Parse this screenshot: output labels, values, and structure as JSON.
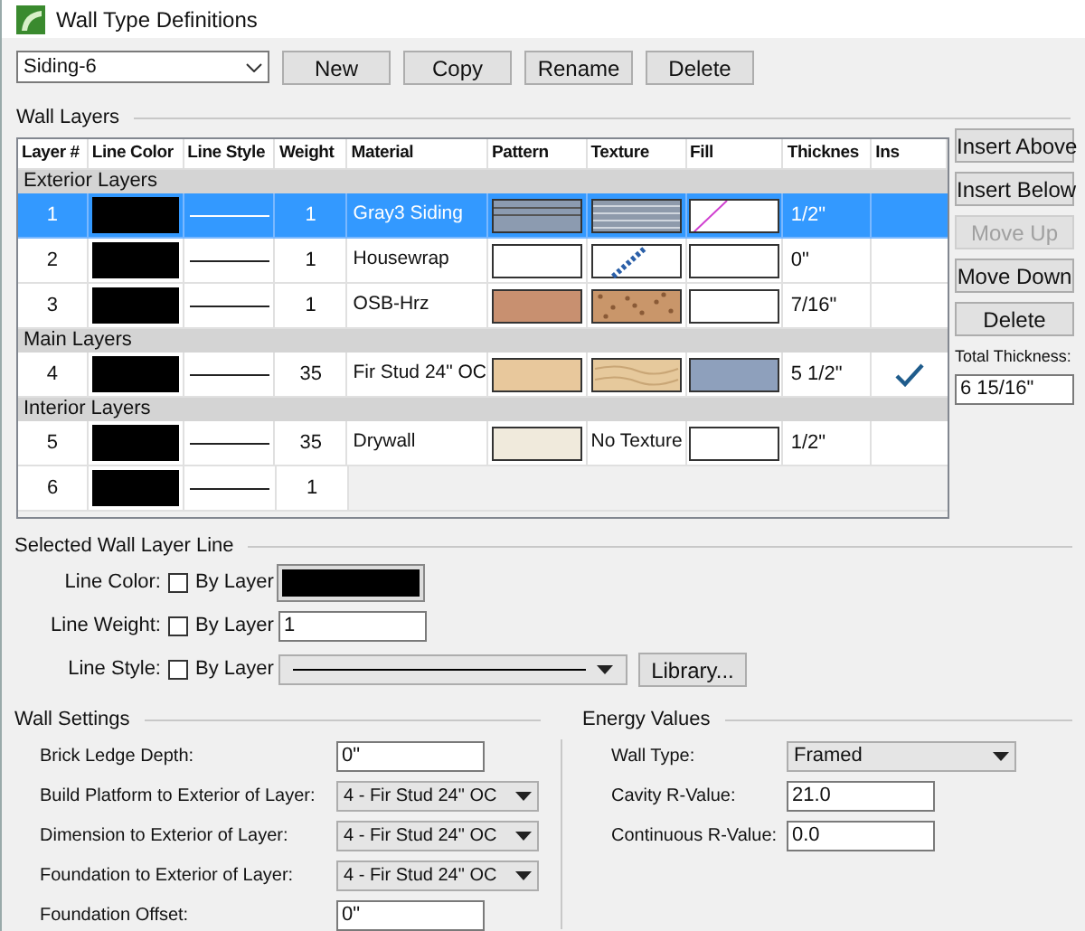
{
  "window": {
    "title": "Wall Type Definitions"
  },
  "toolbar": {
    "wall_type": "Siding-6",
    "buttons": [
      "New",
      "Copy",
      "Rename",
      "Delete"
    ]
  },
  "wall_layers": {
    "title": "Wall Layers",
    "columns": [
      "Layer #",
      "Line Color",
      "Line Style",
      "Weight",
      "Material",
      "Pattern",
      "Texture",
      "Fill",
      "Thicknes",
      "Ins"
    ],
    "rows": [
      {
        "kind": "group",
        "label": "Exterior Layers"
      },
      {
        "kind": "layer",
        "selected": true,
        "number": "1",
        "weight": "1",
        "material": "Gray3 Siding",
        "pattern": {
          "kind": "siding",
          "color": "#8c9bb0"
        },
        "texture": {
          "kind": "siding"
        },
        "fill": {
          "kind": "hatch",
          "color": "#ffffff"
        },
        "thickness": "1/2\"",
        "insulation": false
      },
      {
        "kind": "layer",
        "selected": false,
        "number": "2",
        "weight": "1",
        "material": "Housewrap",
        "pattern": {
          "kind": "plain",
          "color": "#ffffff"
        },
        "texture": {
          "kind": "wrap"
        },
        "fill": {
          "kind": "plain",
          "color": "#ffffff"
        },
        "thickness": "0\"",
        "insulation": false
      },
      {
        "kind": "layer",
        "selected": false,
        "number": "3",
        "weight": "1",
        "material": "OSB-Hrz",
        "pattern": {
          "kind": "plain",
          "color": "#c89070"
        },
        "texture": {
          "kind": "osb"
        },
        "fill": {
          "kind": "plain",
          "color": "#ffffff"
        },
        "thickness": "7/16\"",
        "insulation": false
      },
      {
        "kind": "group",
        "label": "Main Layers"
      },
      {
        "kind": "layer",
        "selected": false,
        "number": "4",
        "weight": "35",
        "material": "Fir Stud 24\" OC",
        "pattern": {
          "kind": "plain",
          "color": "#e8c89c"
        },
        "texture": {
          "kind": "wood"
        },
        "fill": {
          "kind": "plain",
          "color": "#8ea0bc"
        },
        "thickness": "5 1/2\"",
        "insulation": true
      },
      {
        "kind": "group",
        "label": "Interior Layers"
      },
      {
        "kind": "layer",
        "selected": false,
        "number": "5",
        "weight": "35",
        "material": "Drywall",
        "pattern": {
          "kind": "plain",
          "color": "#f0eadc"
        },
        "texture": {
          "kind": "none",
          "label": "No Texture"
        },
        "fill": {
          "kind": "plain",
          "color": "#ffffff"
        },
        "thickness": "1/2\"",
        "insulation": false
      },
      {
        "kind": "layer",
        "selected": false,
        "number": "6",
        "weight": "1"
      }
    ],
    "side_buttons": [
      {
        "label": "Insert Above",
        "disabled": false
      },
      {
        "label": "Insert Below",
        "disabled": false
      },
      {
        "label": "Move Up",
        "disabled": true
      },
      {
        "label": "Move Down",
        "disabled": false
      },
      {
        "label": "Delete",
        "disabled": false
      }
    ],
    "total_thickness": {
      "label": "Total Thickness:",
      "value": "6 15/16\""
    }
  },
  "selected_line": {
    "title": "Selected Wall Layer Line",
    "rows": [
      {
        "kind": "color",
        "label": "Line Color:",
        "by_layer": "By Layer",
        "checked": false
      },
      {
        "kind": "weight",
        "label": "Line Weight:",
        "by_layer": "By Layer",
        "checked": false,
        "value": "1"
      },
      {
        "kind": "style",
        "label": "Line Style:",
        "by_layer": "By Layer",
        "checked": false,
        "button": "Library..."
      }
    ]
  },
  "wall_settings": {
    "title": "Wall Settings",
    "fields": [
      {
        "kind": "input",
        "label": "Brick Ledge Depth:",
        "value": "0\""
      },
      {
        "kind": "select",
        "label": "Build Platform to Exterior of Layer:",
        "value": "4 - Fir Stud 24\" OC"
      },
      {
        "kind": "select",
        "label": "Dimension to Exterior of Layer:",
        "value": "4 - Fir Stud 24\" OC"
      },
      {
        "kind": "select",
        "label": "Foundation to Exterior of Layer:",
        "value": "4 - Fir Stud 24\" OC"
      },
      {
        "kind": "input",
        "label": "Foundation Offset:",
        "value": "0\""
      }
    ]
  },
  "energy_values": {
    "title": "Energy Values",
    "fields": [
      {
        "kind": "select",
        "label": "Wall Type:",
        "value": "Framed"
      },
      {
        "kind": "input",
        "label": "Cavity R-Value:",
        "value": "21.0"
      },
      {
        "kind": "input",
        "label": "Continuous R-Value:",
        "value": "0.0"
      }
    ]
  }
}
